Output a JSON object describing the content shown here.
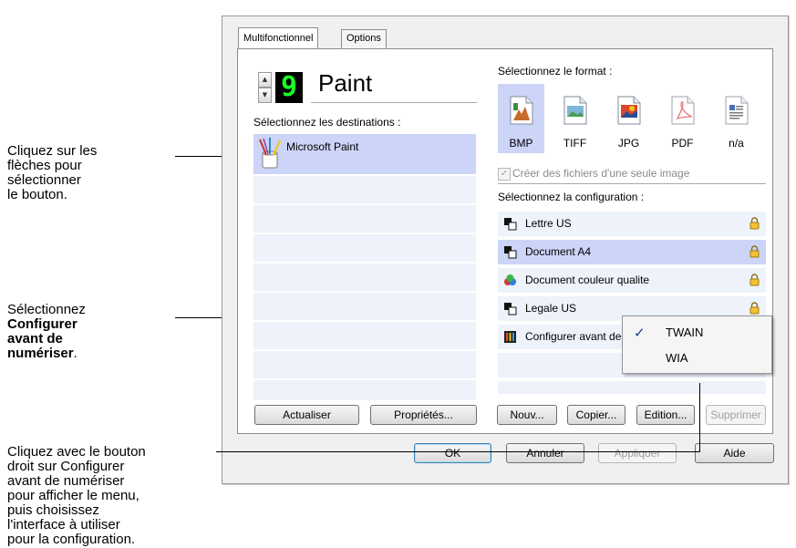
{
  "callouts": {
    "arrows": [
      "Cliquez sur les",
      "flèches pour",
      "sélectionner",
      "le bouton."
    ],
    "configure_before": {
      "line1": "Sélectionnez",
      "line2": "Configurer",
      "line3": "avant de",
      "line4": "numériser",
      "line4_suffix": "."
    },
    "right_click": [
      "Cliquez avec le bouton",
      "droit sur Configurer",
      "avant de numériser",
      "pour afficher le menu,",
      "puis choisissez",
      "l'interface à utiliser",
      "pour la configuration."
    ]
  },
  "tabs": [
    {
      "label": "Multifonctionnel",
      "active": true
    },
    {
      "label": "Options",
      "active": false
    }
  ],
  "button_selector": {
    "number": "9",
    "name": "Paint"
  },
  "destinations": {
    "label": "Sélectionnez les destinations :",
    "items": [
      {
        "label": "Microsoft Paint",
        "icon": "paint-brushes-icon",
        "selected": true
      }
    ]
  },
  "format": {
    "label": "Sélectionnez le format :",
    "items": [
      {
        "label": "BMP",
        "icon": "bmp-file-icon",
        "selected": true
      },
      {
        "label": "TIFF",
        "icon": "tiff-file-icon",
        "selected": false
      },
      {
        "label": "JPG",
        "icon": "jpg-file-icon",
        "selected": false
      },
      {
        "label": "PDF",
        "icon": "pdf-file-icon",
        "selected": false
      },
      {
        "label": "n/a",
        "icon": "text-file-icon",
        "selected": false
      }
    ],
    "single_image_checkbox": "Créer des fichiers d'une seule image"
  },
  "configuration": {
    "label": "Sélectionnez la configuration :",
    "items": [
      {
        "label": "Lettre US",
        "icon": "bw-scan-icon",
        "selected": false
      },
      {
        "label": "Document A4",
        "icon": "bw-scan-icon",
        "selected": true
      },
      {
        "label": "Document couleur qualite",
        "icon": "color-scan-icon",
        "selected": false
      },
      {
        "label": "Legale US",
        "icon": "bw-scan-icon",
        "selected": false
      },
      {
        "label": "Configurer avant de numériser",
        "icon": "configure-icon",
        "selected": false
      }
    ]
  },
  "context_menu": [
    {
      "label": "TWAIN",
      "checked": true
    },
    {
      "label": "WIA",
      "checked": false
    }
  ],
  "buttons": {
    "refresh": "Actualiser",
    "properties": "Propriétés...",
    "new": "Nouv...",
    "copy": "Copier...",
    "edit": "Edition...",
    "delete": "Supprimer",
    "ok": "OK",
    "cancel": "Annuler",
    "apply": "Appliquer",
    "help": "Aide"
  },
  "colors": {
    "selection": "#ccd4f7",
    "list_row": "#eef2fb",
    "lcd_digit": "#18ff27"
  }
}
